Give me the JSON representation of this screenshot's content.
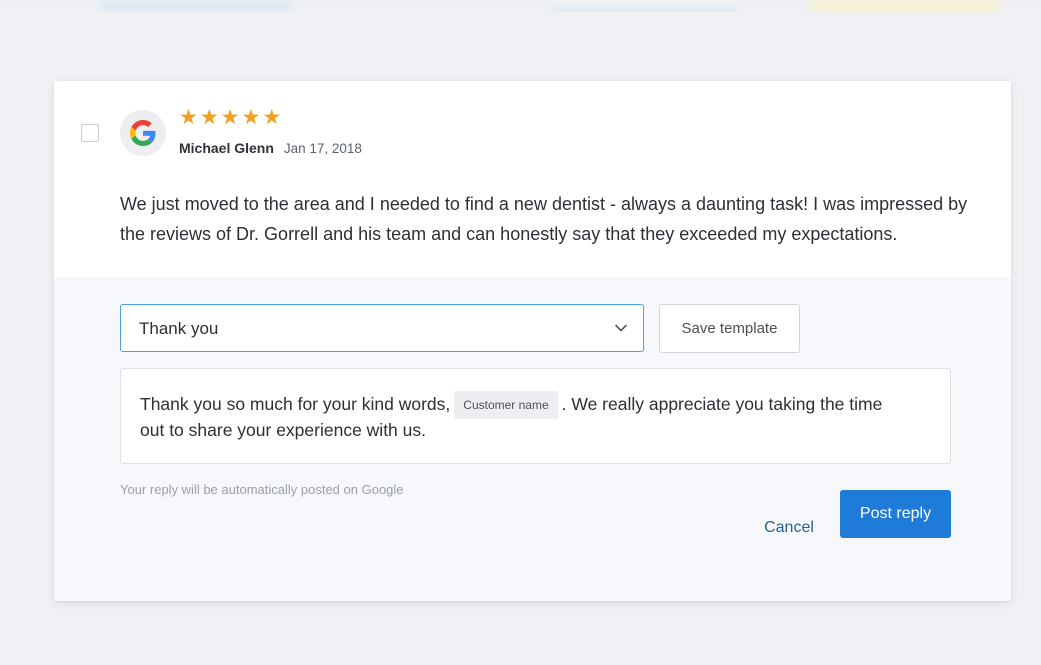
{
  "review": {
    "source_icon": "google-g-icon",
    "rating_stars": 5,
    "stars": [
      "★",
      "★",
      "★",
      "★",
      "★"
    ],
    "reviewer_name": "Michael Glenn",
    "date": "Jan 17, 2018",
    "text": "We just moved to the area and I needed to find a new dentist - always a daunting task! I was impressed by the reviews of Dr. Gorrell and his team and can honestly say that they exceeded my expectations."
  },
  "reply": {
    "template_select_value": "Thank you",
    "save_template_label": "Save template",
    "text_before_token": "Thank you so much for your kind words,",
    "token_label": "Customer name",
    "text_after_token": ". We really appreciate you taking the time out to share your experience with us.",
    "hint": "Your reply will be automatically posted on Google",
    "cancel_label": "Cancel",
    "post_label": "Post reply"
  },
  "colors": {
    "star": "#f4a01f",
    "primary_button": "#1f7bd8",
    "select_border": "#4a9fe0",
    "cancel_link": "#2a5f95"
  }
}
